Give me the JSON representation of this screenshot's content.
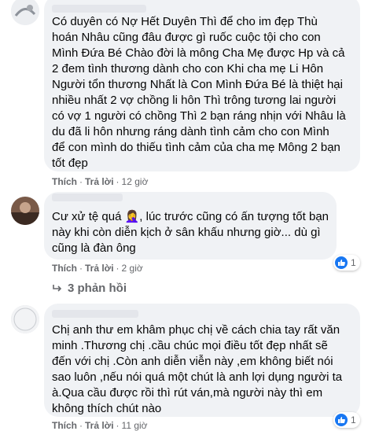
{
  "comments": [
    {
      "text": "Có duyên có Nợ Hết Duyên Thì để cho im đẹp Thù\nhoán Nhâu cũng đâu được gì ruốc cuộc tội cho con\nMình Đứa Bé Chào đời là mông Cha Mẹ được Hp và cả\n2 đem tình thương dành cho con Khi cha mẹ Li Hôn\nNgười tổn thương Nhất là Con Mình Đứa Bé là thiệt hại\nnhiều nhất 2 vợ chồng li hôn Thì trông tương lai người\ncó vợ 1 người có chồng Thì 2 bạn ráng nhịn với Nhâu là\ndu đã li hôn nhưng ráng dành tình cảm cho con Mình\nđể con mình do thiếu tình cảm của cha mẹ Mông 2 bạn\ntốt đẹp",
      "like_label": "Thích",
      "reply_label": "Trả lời",
      "time": "12 giờ"
    },
    {
      "text": "Cư xử tệ quá 🤦‍♀️, lúc trước cũng có ấn tượng tốt bạn\nnày khi còn diễn kịch ở sân khấu nhưng giờ... dù gì\ncũng là đàn ông",
      "like_label": "Thích",
      "reply_label": "Trả lời",
      "time": "2 giờ",
      "reaction_count": "1"
    },
    {
      "text": "Chị anh thư em khâm phục chị về cách chia tay rất văn\nminh .Thương chị .cầu chúc mọi điều tốt đẹp nhất sẽ\nđến với chị .Còn anh diễn viễn này ,em không biết nói\nsao luôn ,nếu nói quá một chút là anh lợi dụng người ta\nà.Qua cầu được rồi thì rút ván,mà người này thì em\nkhông thích chút nào",
      "like_label": "Thích",
      "reply_label": "Trả lời",
      "time": "11 giờ",
      "reaction_count": "1"
    }
  ],
  "replies_label": "3 phản hồi",
  "colors": {
    "bubble": "#f0f2f5",
    "meta": "#65676b",
    "like_blue": "#1877f2"
  }
}
